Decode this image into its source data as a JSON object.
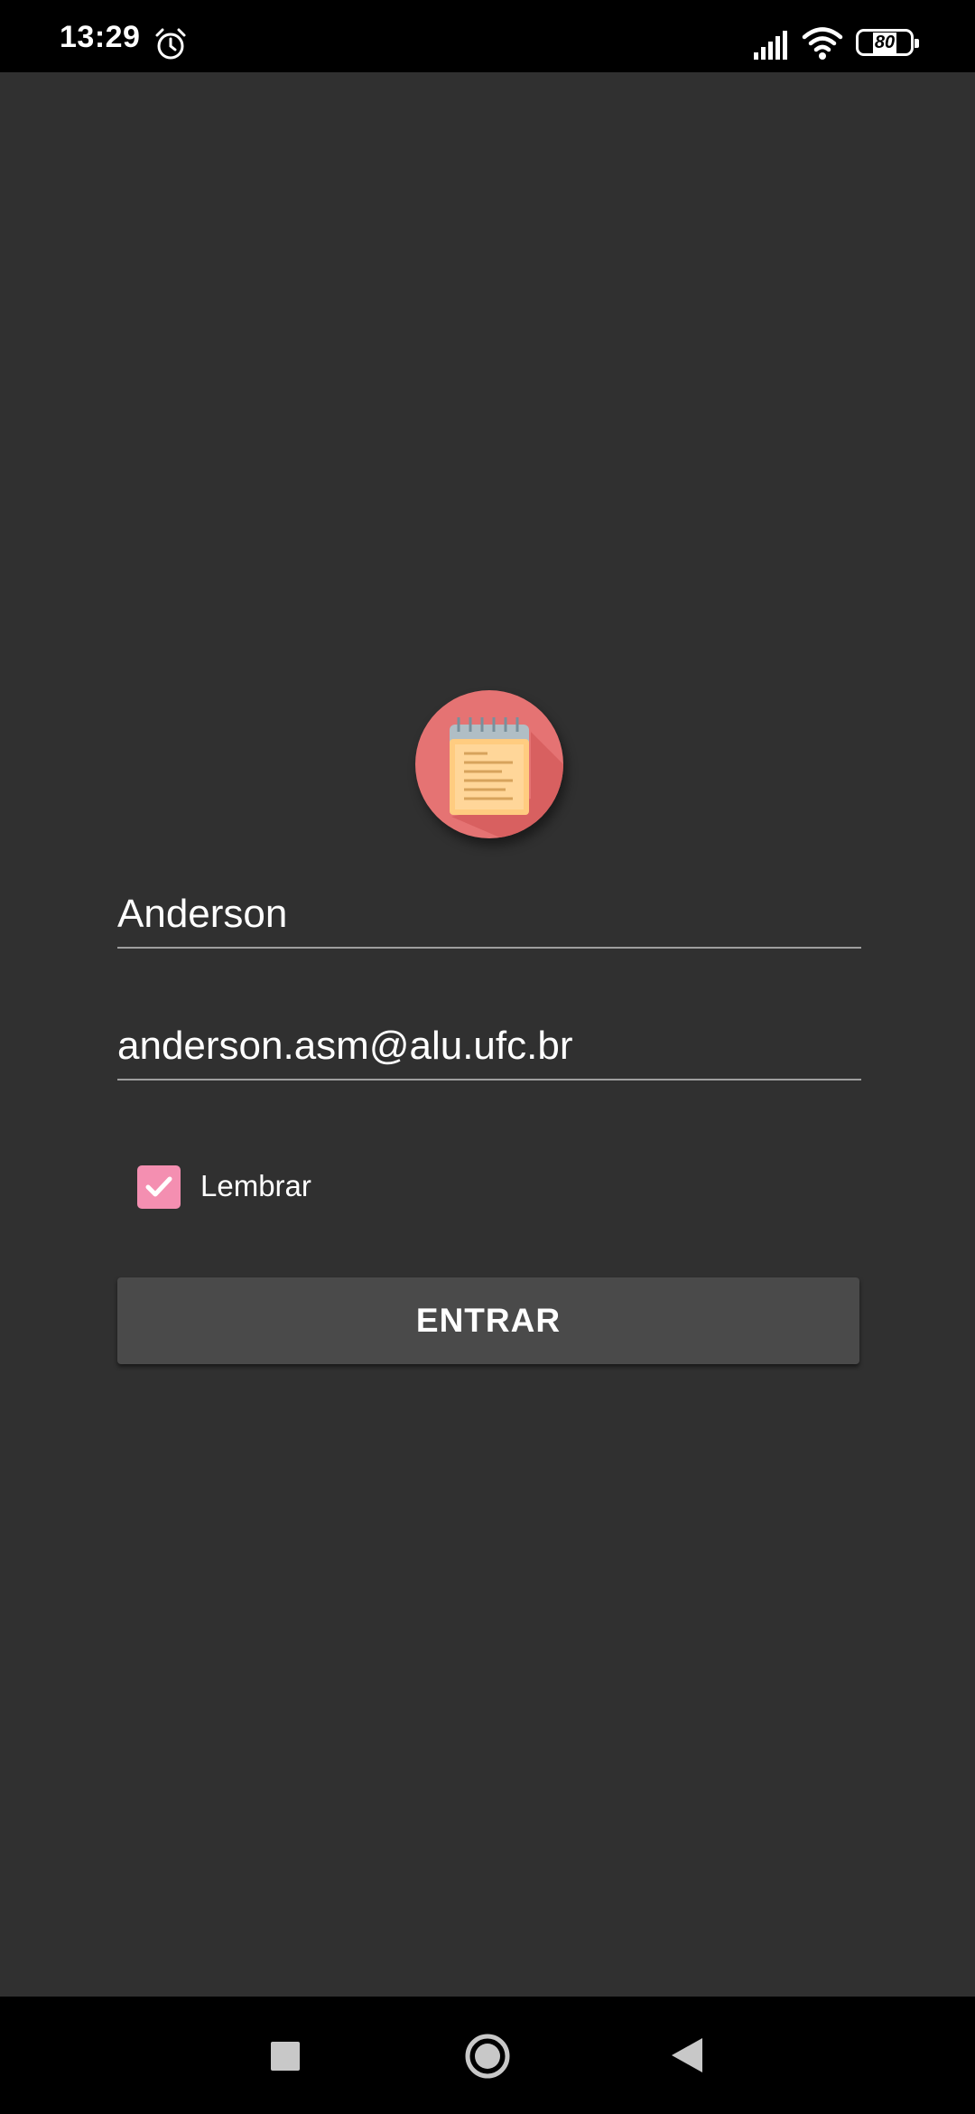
{
  "status_bar": {
    "time": "13:29",
    "battery_level": "80",
    "icons": [
      "alarm-icon",
      "signal-icon",
      "wifi-icon",
      "battery-icon"
    ]
  },
  "login": {
    "name_value": "Anderson",
    "email_value": "anderson.asm@alu.ufc.br",
    "remember_label": "Lembrar",
    "remember_checked": true,
    "submit_label": "ENTRAR"
  },
  "nav_bar": {
    "icons": [
      "recents-icon",
      "home-icon",
      "back-icon"
    ]
  },
  "colors": {
    "background": "#303030",
    "logo_circle": "#e57373",
    "checkbox": "#f48fb1",
    "button": "#4a4a4a"
  }
}
